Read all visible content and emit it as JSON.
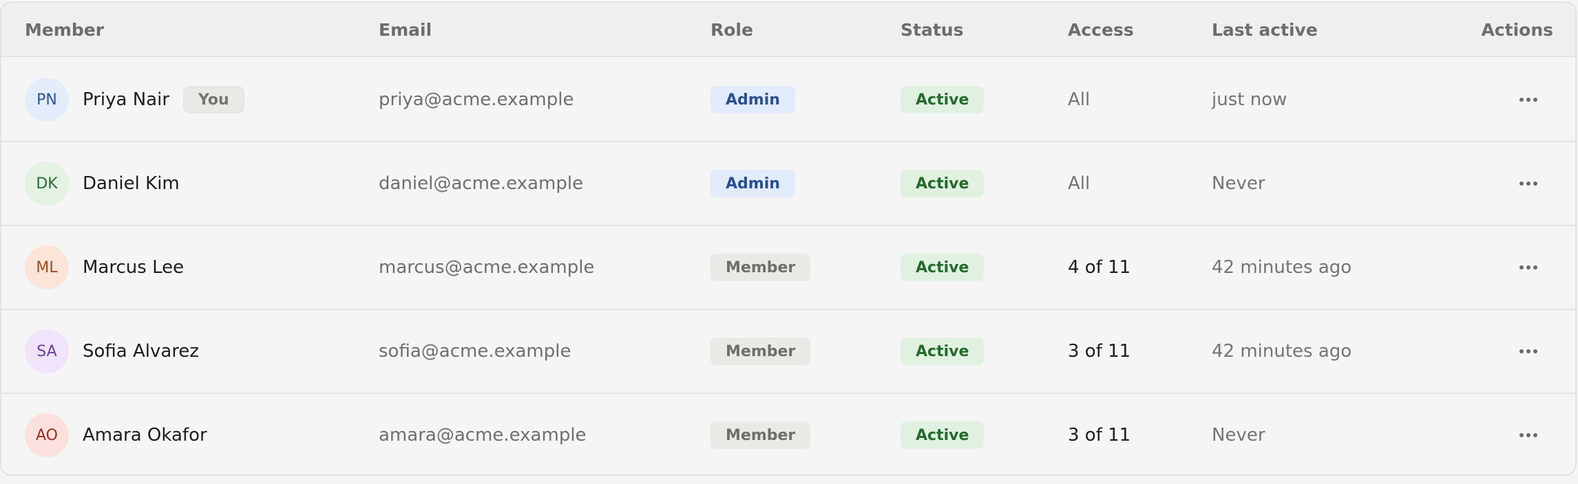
{
  "columns": {
    "member": "Member",
    "email": "Email",
    "role": "Role",
    "status": "Status",
    "access": "Access",
    "last_active": "Last active",
    "actions": "Actions"
  },
  "you_label": "You",
  "colors": {
    "admin_bg": "#e2ebfa",
    "admin_fg": "#2a4f8f",
    "member_bg": "#e9e9e6",
    "member_fg": "#6f6f6a",
    "active_bg": "#e1f1e1",
    "active_fg": "#256a2c"
  },
  "rows": [
    {
      "initials": "PN",
      "name": "Priya Nair",
      "is_you": true,
      "email": "priya@acme.example",
      "role": "Admin",
      "status": "Active",
      "access": "All",
      "last_active": "just now",
      "avatar_bg": "#e4ecfb",
      "avatar_fg": "#2f5594",
      "actions_icon": "more-horizontal-icon"
    },
    {
      "initials": "DK",
      "name": "Daniel Kim",
      "is_you": false,
      "email": "daniel@acme.example",
      "role": "Admin",
      "status": "Active",
      "access": "All",
      "last_active": "Never",
      "avatar_bg": "#e3f2e3",
      "avatar_fg": "#2a6a33",
      "actions_icon": "more-horizontal-icon"
    },
    {
      "initials": "ML",
      "name": "Marcus Lee",
      "is_you": false,
      "email": "marcus@acme.example",
      "role": "Member",
      "status": "Active",
      "access": "4 of 11",
      "last_active": "42 minutes ago",
      "avatar_bg": "#fbe4d8",
      "avatar_fg": "#9a4a20",
      "actions_icon": "more-horizontal-icon"
    },
    {
      "initials": "SA",
      "name": "Sofia Alvarez",
      "is_you": false,
      "email": "sofia@acme.example",
      "role": "Member",
      "status": "Active",
      "access": "3 of 11",
      "last_active": "42 minutes ago",
      "avatar_bg": "#efe4fa",
      "avatar_fg": "#6a3e96",
      "actions_icon": "more-horizontal-icon"
    },
    {
      "initials": "AO",
      "name": "Amara Okafor",
      "is_you": false,
      "email": "amara@acme.example",
      "role": "Member",
      "status": "Active",
      "access": "3 of 11",
      "last_active": "Never",
      "avatar_bg": "#fbe1dd",
      "avatar_fg": "#9a2f26",
      "actions_icon": "more-horizontal-icon"
    }
  ]
}
